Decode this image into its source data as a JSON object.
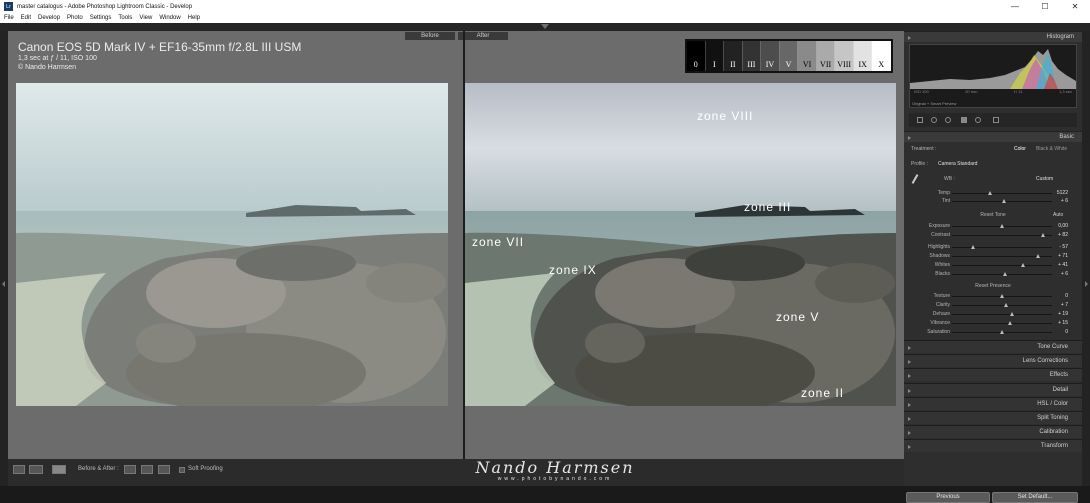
{
  "window": {
    "app_icon": "Lr",
    "title": "master catalogus - Adobe Photoshop Lightroom Classic - Develop",
    "controls": [
      "—",
      "☐",
      "✕"
    ]
  },
  "menu": [
    "File",
    "Edit",
    "Develop",
    "Photo",
    "Settings",
    "Tools",
    "View",
    "Window",
    "Help"
  ],
  "view": {
    "before_label": "Before",
    "after_label": "After",
    "info": {
      "camera": "Canon EOS 5D Mark IV + EF16-35mm f/2.8L III USM",
      "exposure": "1,3 sec at ƒ / 11, ISO 100",
      "copyright": "© Nando Harmsen"
    },
    "zone_scale": [
      "0",
      "I",
      "II",
      "III",
      "IV",
      "V",
      "VI",
      "VII",
      "VIII",
      "IX",
      "X"
    ],
    "zone_colors": [
      "#000000",
      "#111111",
      "#222222",
      "#333333",
      "#4d4d4d",
      "#676767",
      "#8a8a8a",
      "#aaaaaa",
      "#c6c6c6",
      "#e2e2e2",
      "#ffffff"
    ],
    "zone_labels": [
      "zone VIII",
      "zone III",
      "zone VII",
      "zone IX",
      "zone V",
      "zone II"
    ]
  },
  "bottom": {
    "before_after": "Before & After :",
    "soft_proofing": "Soft Proofing",
    "watermark_name": "Nando Harmsen",
    "watermark_url": "www.photobynando.com"
  },
  "panel": {
    "histogram": "Histogram",
    "histo_meta": [
      "ISO 100",
      "20 mm",
      "f / 11",
      "1,3 sec"
    ],
    "preview": "Original + Smart Preview",
    "basic": "Basic",
    "treatment_label": "Treatment :",
    "treatment_color": "Color",
    "treatment_bw": "Black & White",
    "profile_label": "Profile :",
    "profile_value": "Camera Standard",
    "wb_label": "WB :",
    "wb_value": "Custom",
    "tone_title": "Reset Tone",
    "auto": "Auto",
    "presence_title": "Reset Presence",
    "sliders_wb": [
      {
        "label": "Temp",
        "value": "5122",
        "pos": 0.38
      },
      {
        "label": "Tint",
        "value": "+ 6",
        "pos": 0.52
      }
    ],
    "sliders_tone": [
      {
        "label": "Exposure",
        "value": "0,00",
        "pos": 0.5
      },
      {
        "label": "Contrast",
        "value": "+ 82",
        "pos": 0.91
      }
    ],
    "sliders_tone2": [
      {
        "label": "Highlights",
        "value": "- 57",
        "pos": 0.21
      },
      {
        "label": "Shadows",
        "value": "+ 71",
        "pos": 0.86
      },
      {
        "label": "Whites",
        "value": "+ 41",
        "pos": 0.71
      },
      {
        "label": "Blacks",
        "value": "+ 6",
        "pos": 0.53
      }
    ],
    "sliders_presence": [
      {
        "label": "Texture",
        "value": "0",
        "pos": 0.5
      },
      {
        "label": "Clarity",
        "value": "+ 7",
        "pos": 0.54
      },
      {
        "label": "Dehaze",
        "value": "+ 19",
        "pos": 0.6
      },
      {
        "label": "Vibrance",
        "value": "+ 15",
        "pos": 0.58
      },
      {
        "label": "Saturation",
        "value": "0",
        "pos": 0.5
      }
    ],
    "sections": [
      "Tone Curve",
      "Lens Corrections",
      "Effects",
      "Detail",
      "HSL / Color",
      "Split Toning",
      "Calibration",
      "Transform"
    ],
    "previous": "Previous",
    "set_default": "Set Default..."
  }
}
